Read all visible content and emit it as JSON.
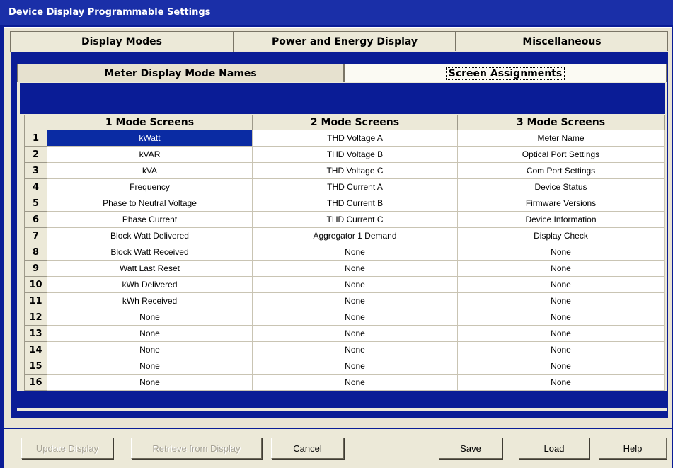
{
  "window": {
    "title": "Device Display Programmable Settings"
  },
  "tabs": [
    "Display Modes",
    "Power and Energy Display",
    "Miscellaneous"
  ],
  "subtabs": [
    "Meter Display Mode Names",
    "Screen Assignments"
  ],
  "grid": {
    "headers": [
      "1 Mode Screens",
      "2 Mode Screens",
      "3 Mode Screens"
    ],
    "rows": [
      {
        "n": "1",
        "c": [
          "kWatt",
          "THD Voltage A",
          "Meter Name"
        ]
      },
      {
        "n": "2",
        "c": [
          "kVAR",
          "THD Voltage B",
          "Optical Port Settings"
        ]
      },
      {
        "n": "3",
        "c": [
          "kVA",
          "THD Voltage C",
          "Com Port Settings"
        ]
      },
      {
        "n": "4",
        "c": [
          "Frequency",
          "THD Current A",
          "Device Status"
        ]
      },
      {
        "n": "5",
        "c": [
          "Phase to Neutral Voltage",
          "THD Current B",
          "Firmware Versions"
        ]
      },
      {
        "n": "6",
        "c": [
          "Phase Current",
          "THD Current C",
          "Device Information"
        ]
      },
      {
        "n": "7",
        "c": [
          "Block Watt Delivered",
          "Aggregator 1 Demand",
          "Display Check"
        ]
      },
      {
        "n": "8",
        "c": [
          "Block Watt Received",
          "None",
          "None"
        ]
      },
      {
        "n": "9",
        "c": [
          "Watt Last Reset",
          "None",
          "None"
        ]
      },
      {
        "n": "10",
        "c": [
          "kWh Delivered",
          "None",
          "None"
        ]
      },
      {
        "n": "11",
        "c": [
          "kWh Received",
          "None",
          "None"
        ]
      },
      {
        "n": "12",
        "c": [
          "None",
          "None",
          "None"
        ]
      },
      {
        "n": "13",
        "c": [
          "None",
          "None",
          "None"
        ]
      },
      {
        "n": "14",
        "c": [
          "None",
          "None",
          "None"
        ]
      },
      {
        "n": "15",
        "c": [
          "None",
          "None",
          "None"
        ]
      },
      {
        "n": "16",
        "c": [
          "None",
          "None",
          "None"
        ]
      }
    ]
  },
  "buttons": {
    "update": "Update Display",
    "retrieve": "Retrieve from Display",
    "cancel": "Cancel",
    "save": "Save",
    "load": "Load",
    "help": "Help"
  },
  "colors": {
    "window_blue": "#0a1c96",
    "panel": "#ece9d8",
    "selection": "#0a2ba3"
  }
}
